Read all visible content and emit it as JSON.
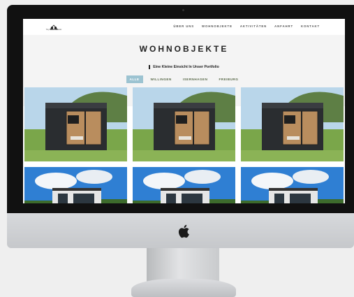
{
  "site": {
    "logo_caption": "Tiny House Kollektiv",
    "nav": [
      "ÜBER UNS",
      "WOHNOBJEKTE",
      "AKTIVITÄTEN",
      "ANFAHRT",
      "KONTAKT"
    ],
    "title": "WOHNOBJEKTE",
    "subtitle": "Eine Kleine Einsicht In Unser Portfolio",
    "filters": [
      "ALLE",
      "WILLINGEN",
      "ISERNHAGEN",
      "FREIBURG"
    ],
    "active_filter": "ALLE"
  },
  "colors": {
    "accent": "#9cc3d1",
    "filter_text": "#5a6a4a",
    "frame": "#111111"
  },
  "icons": {
    "brand": "apple-logo"
  }
}
